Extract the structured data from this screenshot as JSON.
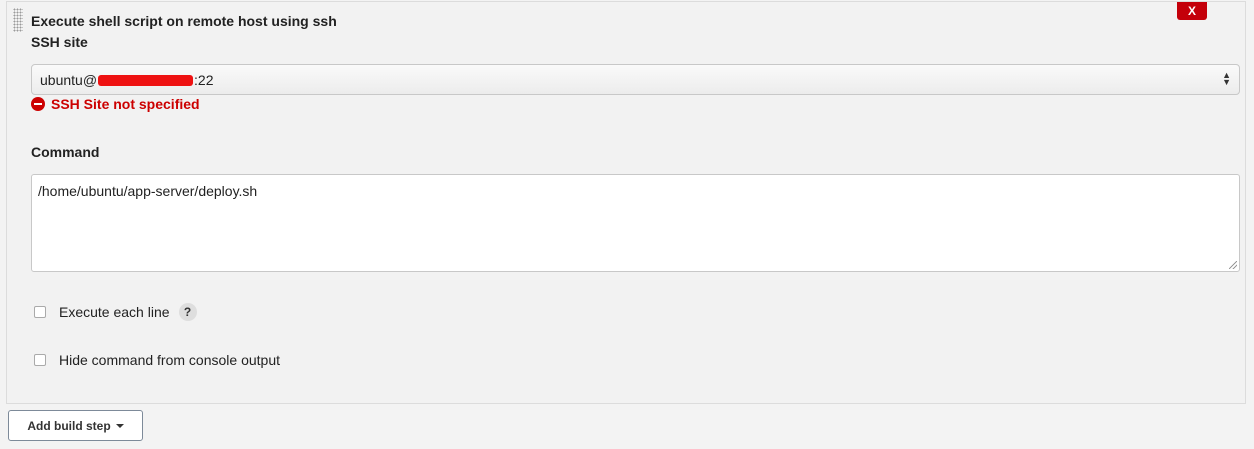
{
  "step": {
    "title": "Execute shell script on remote host using ssh",
    "delete_label": "X"
  },
  "ssh_site": {
    "label": "SSH site",
    "value_prefix": "ubuntu@",
    "value_suffix": ":22",
    "error": "SSH Site not specified"
  },
  "command": {
    "label": "Command",
    "value": "/home/ubuntu/app-server/deploy.sh"
  },
  "options": {
    "execute_each_line": "Execute each line",
    "help_label": "?",
    "hide_command": "Hide command from console output"
  },
  "footer": {
    "add_build_step": "Add build step"
  },
  "colors": {
    "error": "#cc0000",
    "delete_button": "#c4000a",
    "redaction": "#ee1111"
  }
}
